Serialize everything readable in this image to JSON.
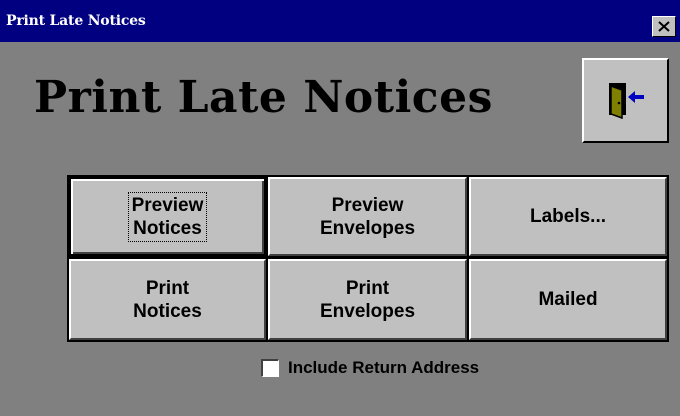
{
  "window": {
    "title": "Print Late Notices"
  },
  "title_bar": {
    "close_glyph": "✕",
    "close_icon": "close-icon"
  },
  "header": {
    "heading": "Print Late Notices",
    "exit_icon": "exit-door-icon"
  },
  "buttons": [
    {
      "label": "Preview\nNotices",
      "is_default": true
    },
    {
      "label": "Preview\nEnvelopes",
      "is_default": false
    },
    {
      "label": "Labels...",
      "is_default": false
    },
    {
      "label": "Print\nNotices",
      "is_default": false
    },
    {
      "label": "Print\nEnvelopes",
      "is_default": false
    },
    {
      "label": "Mailed",
      "is_default": false
    }
  ],
  "options": {
    "include_return_address": {
      "label": "Include Return Address",
      "checked": false
    }
  },
  "colors": {
    "title_bar": "#000080",
    "window_background": "#808080",
    "button_face": "#c0c0c0"
  }
}
